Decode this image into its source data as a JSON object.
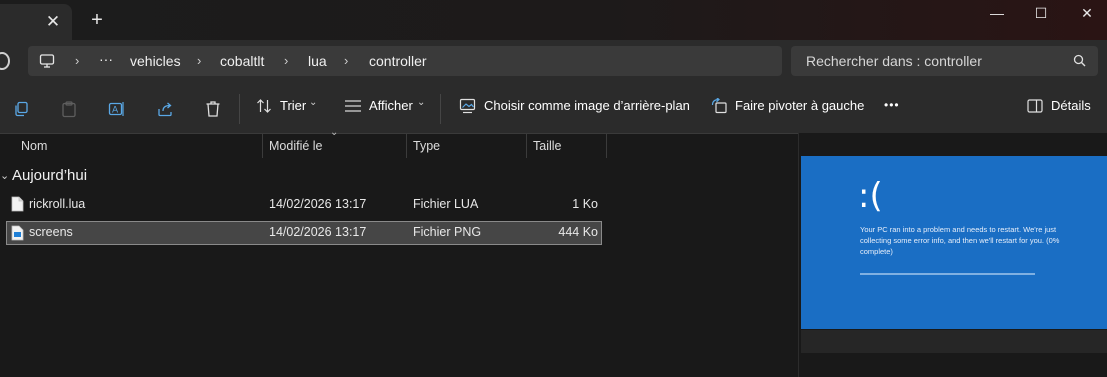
{
  "tab": {
    "close_glyph": "✕",
    "new_glyph": "+"
  },
  "window": {
    "minimize": "—",
    "maximize": "☐",
    "close": "✕"
  },
  "address": {
    "overflow": "···",
    "crumbs": [
      "vehicles",
      "cobaltlt",
      "lua",
      "controller"
    ]
  },
  "search": {
    "placeholder": "Rechercher dans : controller"
  },
  "toolbar": {
    "sort_label": "Trier",
    "view_label": "Afficher",
    "wallpaper_label": "Choisir comme image d’arrière-plan",
    "rotate_label": "Faire pivoter à gauche",
    "more_label": "•••",
    "details_label": "Détails"
  },
  "columns": {
    "name": "Nom",
    "modified": "Modifié le",
    "type": "Type",
    "size": "Taille"
  },
  "group": {
    "label": "Aujourd’hui"
  },
  "files": [
    {
      "name": "rickroll.lua",
      "modified": "14/02/2026 13:17",
      "type": "Fichier LUA",
      "size": "1 Ko"
    },
    {
      "name": "screens",
      "modified": "14/02/2026 13:17",
      "type": "Fichier PNG",
      "size": "444 Ko"
    }
  ],
  "preview": {
    "face": ":(",
    "message": "Your PC ran into a problem and needs to restart. We're just collecting some error info, and then we'll restart for you. (0% complete)"
  },
  "colors": {
    "bsod_blue": "#1a6ec4",
    "selection": "#464646"
  }
}
